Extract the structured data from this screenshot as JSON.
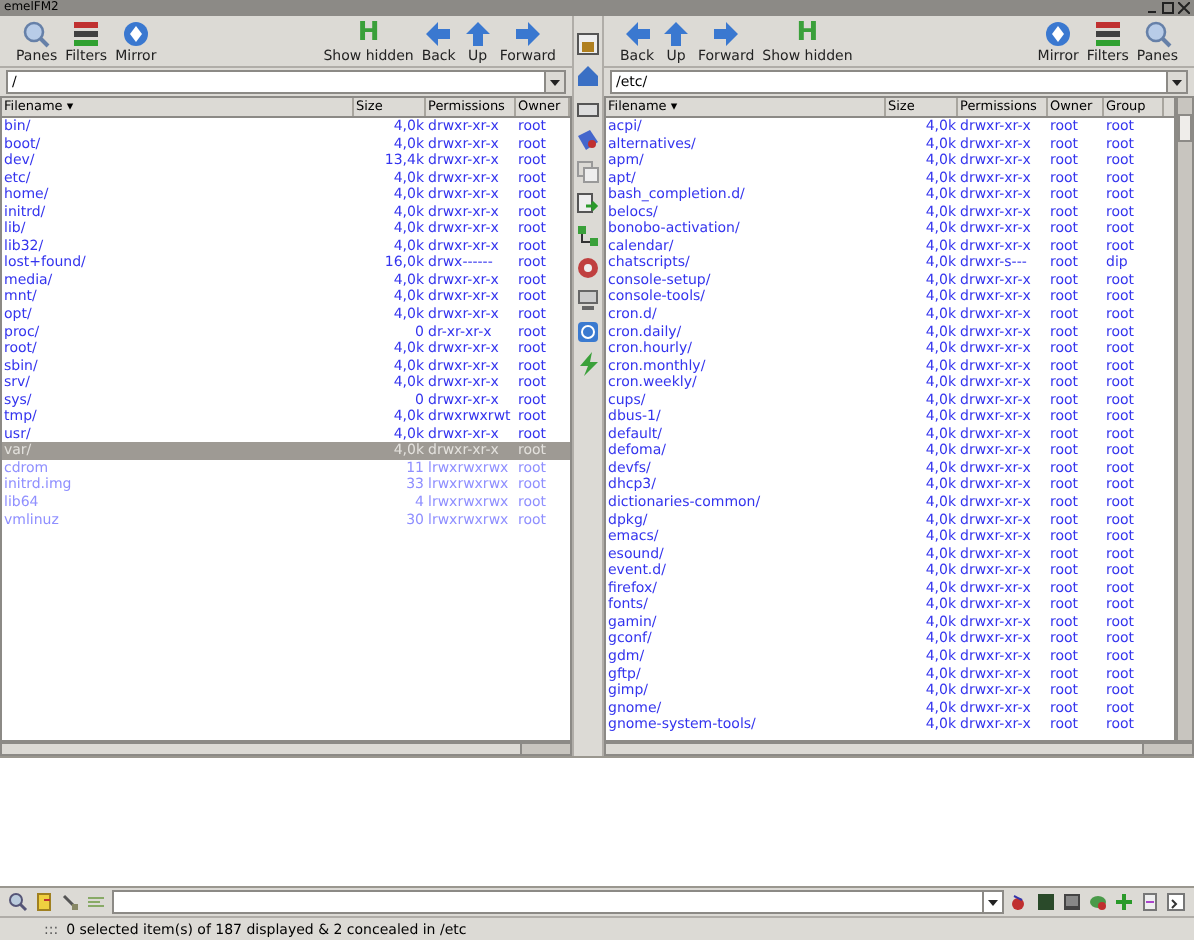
{
  "window": {
    "title": "emelFM2"
  },
  "left_pane": {
    "toolbar": [
      {
        "label": "Panes",
        "kind": "panes"
      },
      {
        "label": "Filters",
        "kind": "filters"
      },
      {
        "label": "Mirror",
        "kind": "mirror"
      },
      {
        "label": "Show hidden",
        "kind": "hidden",
        "glyph": "H"
      },
      {
        "label": "Back",
        "kind": "back"
      },
      {
        "label": "Up",
        "kind": "up"
      },
      {
        "label": "Forward",
        "kind": "forward"
      }
    ],
    "path": "/",
    "columns": [
      "Filename ▾",
      "Size",
      "Permissions",
      "Owner"
    ],
    "rows": [
      {
        "name": "bin/",
        "size": "4,0k",
        "permissions": "drwxr-xr-x",
        "owner": "root",
        "kind": "dir",
        "selected": false
      },
      {
        "name": "boot/",
        "size": "4,0k",
        "permissions": "drwxr-xr-x",
        "owner": "root",
        "kind": "dir",
        "selected": false
      },
      {
        "name": "dev/",
        "size": "13,4k",
        "permissions": "drwxr-xr-x",
        "owner": "root",
        "kind": "dir",
        "selected": false
      },
      {
        "name": "etc/",
        "size": "4,0k",
        "permissions": "drwxr-xr-x",
        "owner": "root",
        "kind": "dir",
        "selected": false
      },
      {
        "name": "home/",
        "size": "4,0k",
        "permissions": "drwxr-xr-x",
        "owner": "root",
        "kind": "dir",
        "selected": false
      },
      {
        "name": "initrd/",
        "size": "4,0k",
        "permissions": "drwxr-xr-x",
        "owner": "root",
        "kind": "dir",
        "selected": false
      },
      {
        "name": "lib/",
        "size": "4,0k",
        "permissions": "drwxr-xr-x",
        "owner": "root",
        "kind": "dir",
        "selected": false
      },
      {
        "name": "lib32/",
        "size": "4,0k",
        "permissions": "drwxr-xr-x",
        "owner": "root",
        "kind": "dir",
        "selected": false
      },
      {
        "name": "lost+found/",
        "size": "16,0k",
        "permissions": "drwx------",
        "owner": "root",
        "kind": "dir",
        "selected": false
      },
      {
        "name": "media/",
        "size": "4,0k",
        "permissions": "drwxr-xr-x",
        "owner": "root",
        "kind": "dir",
        "selected": false
      },
      {
        "name": "mnt/",
        "size": "4,0k",
        "permissions": "drwxr-xr-x",
        "owner": "root",
        "kind": "dir",
        "selected": false
      },
      {
        "name": "opt/",
        "size": "4,0k",
        "permissions": "drwxr-xr-x",
        "owner": "root",
        "kind": "dir",
        "selected": false
      },
      {
        "name": "proc/",
        "size": "0",
        "permissions": "dr-xr-xr-x",
        "owner": "root",
        "kind": "dir",
        "selected": false
      },
      {
        "name": "root/",
        "size": "4,0k",
        "permissions": "drwxr-xr-x",
        "owner": "root",
        "kind": "dir",
        "selected": false
      },
      {
        "name": "sbin/",
        "size": "4,0k",
        "permissions": "drwxr-xr-x",
        "owner": "root",
        "kind": "dir",
        "selected": false
      },
      {
        "name": "srv/",
        "size": "4,0k",
        "permissions": "drwxr-xr-x",
        "owner": "root",
        "kind": "dir",
        "selected": false
      },
      {
        "name": "sys/",
        "size": "0",
        "permissions": "drwxr-xr-x",
        "owner": "root",
        "kind": "dir",
        "selected": false
      },
      {
        "name": "tmp/",
        "size": "4,0k",
        "permissions": "drwxrwxrwt",
        "owner": "root",
        "kind": "dir",
        "selected": false
      },
      {
        "name": "usr/",
        "size": "4,0k",
        "permissions": "drwxr-xr-x",
        "owner": "root",
        "kind": "dir",
        "selected": false
      },
      {
        "name": "var/",
        "size": "4,0k",
        "permissions": "drwxr-xr-x",
        "owner": "root",
        "kind": "dir",
        "selected": true
      },
      {
        "name": "cdrom",
        "size": "11",
        "permissions": "lrwxrwxrwx",
        "owner": "root",
        "kind": "link",
        "selected": false
      },
      {
        "name": "initrd.img",
        "size": "33",
        "permissions": "lrwxrwxrwx",
        "owner": "root",
        "kind": "link",
        "selected": false
      },
      {
        "name": "lib64",
        "size": "4",
        "permissions": "lrwxrwxrwx",
        "owner": "root",
        "kind": "link",
        "selected": false
      },
      {
        "name": "vmlinuz",
        "size": "30",
        "permissions": "lrwxrwxrwx",
        "owner": "root",
        "kind": "link",
        "selected": false
      }
    ]
  },
  "right_pane": {
    "toolbar": [
      {
        "label": "Back",
        "kind": "back"
      },
      {
        "label": "Up",
        "kind": "up"
      },
      {
        "label": "Forward",
        "kind": "forward"
      },
      {
        "label": "Show hidden",
        "kind": "hidden",
        "glyph": "H"
      },
      {
        "label": "Mirror",
        "kind": "mirror"
      },
      {
        "label": "Filters",
        "kind": "filters"
      },
      {
        "label": "Panes",
        "kind": "panes"
      }
    ],
    "path": "/etc/",
    "columns": [
      "Filename ▾",
      "Size",
      "Permissions",
      "Owner",
      "Group"
    ],
    "rows": [
      {
        "name": "acpi/",
        "size": "4,0k",
        "permissions": "drwxr-xr-x",
        "owner": "root",
        "group": "root"
      },
      {
        "name": "alternatives/",
        "size": "4,0k",
        "permissions": "drwxr-xr-x",
        "owner": "root",
        "group": "root"
      },
      {
        "name": "apm/",
        "size": "4,0k",
        "permissions": "drwxr-xr-x",
        "owner": "root",
        "group": "root"
      },
      {
        "name": "apt/",
        "size": "4,0k",
        "permissions": "drwxr-xr-x",
        "owner": "root",
        "group": "root"
      },
      {
        "name": "bash_completion.d/",
        "size": "4,0k",
        "permissions": "drwxr-xr-x",
        "owner": "root",
        "group": "root"
      },
      {
        "name": "belocs/",
        "size": "4,0k",
        "permissions": "drwxr-xr-x",
        "owner": "root",
        "group": "root"
      },
      {
        "name": "bonobo-activation/",
        "size": "4,0k",
        "permissions": "drwxr-xr-x",
        "owner": "root",
        "group": "root"
      },
      {
        "name": "calendar/",
        "size": "4,0k",
        "permissions": "drwxr-xr-x",
        "owner": "root",
        "group": "root"
      },
      {
        "name": "chatscripts/",
        "size": "4,0k",
        "permissions": "drwxr-s---",
        "owner": "root",
        "group": "dip"
      },
      {
        "name": "console-setup/",
        "size": "4,0k",
        "permissions": "drwxr-xr-x",
        "owner": "root",
        "group": "root"
      },
      {
        "name": "console-tools/",
        "size": "4,0k",
        "permissions": "drwxr-xr-x",
        "owner": "root",
        "group": "root"
      },
      {
        "name": "cron.d/",
        "size": "4,0k",
        "permissions": "drwxr-xr-x",
        "owner": "root",
        "group": "root"
      },
      {
        "name": "cron.daily/",
        "size": "4,0k",
        "permissions": "drwxr-xr-x",
        "owner": "root",
        "group": "root"
      },
      {
        "name": "cron.hourly/",
        "size": "4,0k",
        "permissions": "drwxr-xr-x",
        "owner": "root",
        "group": "root"
      },
      {
        "name": "cron.monthly/",
        "size": "4,0k",
        "permissions": "drwxr-xr-x",
        "owner": "root",
        "group": "root"
      },
      {
        "name": "cron.weekly/",
        "size": "4,0k",
        "permissions": "drwxr-xr-x",
        "owner": "root",
        "group": "root"
      },
      {
        "name": "cups/",
        "size": "4,0k",
        "permissions": "drwxr-xr-x",
        "owner": "root",
        "group": "root"
      },
      {
        "name": "dbus-1/",
        "size": "4,0k",
        "permissions": "drwxr-xr-x",
        "owner": "root",
        "group": "root"
      },
      {
        "name": "default/",
        "size": "4,0k",
        "permissions": "drwxr-xr-x",
        "owner": "root",
        "group": "root"
      },
      {
        "name": "defoma/",
        "size": "4,0k",
        "permissions": "drwxr-xr-x",
        "owner": "root",
        "group": "root"
      },
      {
        "name": "devfs/",
        "size": "4,0k",
        "permissions": "drwxr-xr-x",
        "owner": "root",
        "group": "root"
      },
      {
        "name": "dhcp3/",
        "size": "4,0k",
        "permissions": "drwxr-xr-x",
        "owner": "root",
        "group": "root"
      },
      {
        "name": "dictionaries-common/",
        "size": "4,0k",
        "permissions": "drwxr-xr-x",
        "owner": "root",
        "group": "root"
      },
      {
        "name": "dpkg/",
        "size": "4,0k",
        "permissions": "drwxr-xr-x",
        "owner": "root",
        "group": "root"
      },
      {
        "name": "emacs/",
        "size": "4,0k",
        "permissions": "drwxr-xr-x",
        "owner": "root",
        "group": "root"
      },
      {
        "name": "esound/",
        "size": "4,0k",
        "permissions": "drwxr-xr-x",
        "owner": "root",
        "group": "root"
      },
      {
        "name": "event.d/",
        "size": "4,0k",
        "permissions": "drwxr-xr-x",
        "owner": "root",
        "group": "root"
      },
      {
        "name": "firefox/",
        "size": "4,0k",
        "permissions": "drwxr-xr-x",
        "owner": "root",
        "group": "root"
      },
      {
        "name": "fonts/",
        "size": "4,0k",
        "permissions": "drwxr-xr-x",
        "owner": "root",
        "group": "root"
      },
      {
        "name": "gamin/",
        "size": "4,0k",
        "permissions": "drwxr-xr-x",
        "owner": "root",
        "group": "root"
      },
      {
        "name": "gconf/",
        "size": "4,0k",
        "permissions": "drwxr-xr-x",
        "owner": "root",
        "group": "root"
      },
      {
        "name": "gdm/",
        "size": "4,0k",
        "permissions": "drwxr-xr-x",
        "owner": "root",
        "group": "root"
      },
      {
        "name": "gftp/",
        "size": "4,0k",
        "permissions": "drwxr-xr-x",
        "owner": "root",
        "group": "root"
      },
      {
        "name": "gimp/",
        "size": "4,0k",
        "permissions": "drwxr-xr-x",
        "owner": "root",
        "group": "root"
      },
      {
        "name": "gnome/",
        "size": "4,0k",
        "permissions": "drwxr-xr-x",
        "owner": "root",
        "group": "root"
      },
      {
        "name": "gnome-system-tools/",
        "size": "4,0k",
        "permissions": "drwxr-xr-x",
        "owner": "root",
        "group": "root"
      }
    ]
  },
  "status_bar": {
    "grip": ":::",
    "text": "0 selected item(s) of 187 displayed & 2 concealed in /etc"
  }
}
